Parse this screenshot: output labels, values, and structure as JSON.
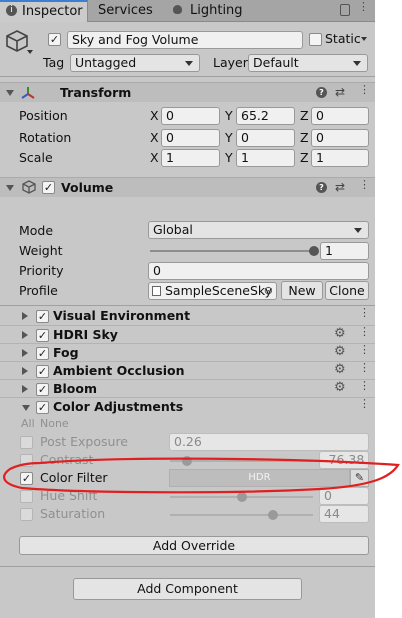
{
  "tabs": [
    {
      "label": "Inspector"
    },
    {
      "label": "Services"
    },
    {
      "label": "Lighting"
    }
  ],
  "object": {
    "name": "Sky and Fog Volume",
    "static_label": "Static",
    "tag_label": "Tag",
    "tag_value": "Untagged",
    "layer_label": "Layer",
    "layer_value": "Default"
  },
  "transform": {
    "title": "Transform",
    "rows": [
      {
        "label": "Position",
        "x": "0",
        "y": "65.2",
        "z": "0"
      },
      {
        "label": "Rotation",
        "x": "0",
        "y": "0",
        "z": "0"
      },
      {
        "label": "Scale",
        "x": "1",
        "y": "1",
        "z": "1"
      }
    ],
    "axis": {
      "x": "X",
      "y": "Y",
      "z": "Z"
    }
  },
  "volume": {
    "title": "Volume",
    "mode_label": "Mode",
    "mode_value": "Global",
    "weight_label": "Weight",
    "weight_value": "1",
    "weight_fraction": 1.0,
    "priority_label": "Priority",
    "priority_value": "0",
    "profile_label": "Profile",
    "profile_value": "SampleSceneSky",
    "new_label": "New",
    "clone_label": "Clone"
  },
  "overrides": [
    {
      "label": "Visual Environment"
    },
    {
      "label": "HDRI Sky"
    },
    {
      "label": "Fog"
    },
    {
      "label": "Ambient Occlusion"
    },
    {
      "label": "Bloom"
    },
    {
      "label": "Color Adjustments"
    }
  ],
  "color_adjustments": {
    "all_label": "All",
    "none_label": "None",
    "post_exposure": {
      "label": "Post Exposure",
      "value": "0.26"
    },
    "contrast": {
      "label": "Contrast",
      "value": "-76.38",
      "fraction": 0.12
    },
    "color_filter": {
      "label": "Color Filter",
      "hdr": "HDR"
    },
    "hue_shift": {
      "label": "Hue Shift",
      "value": "0",
      "fraction": 0.5
    },
    "saturation": {
      "label": "Saturation",
      "value": "44",
      "fraction": 0.72
    }
  },
  "add_override_label": "Add Override",
  "add_component_label": "Add Component",
  "annotation_color": "#e02020"
}
